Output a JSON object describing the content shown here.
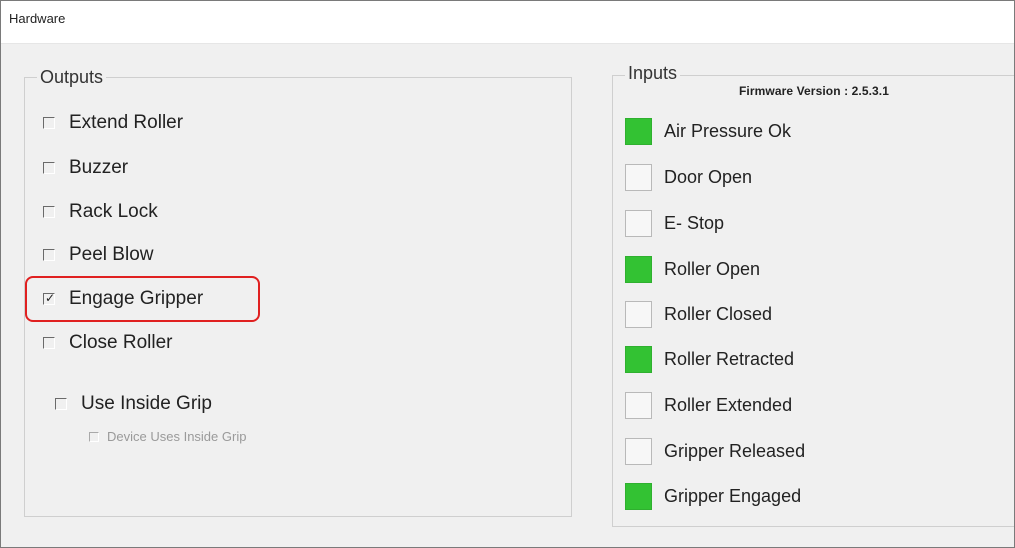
{
  "window": {
    "title": "Hardware"
  },
  "outputs": {
    "legend": "Outputs",
    "items": [
      {
        "label": "Extend Roller",
        "checked": false
      },
      {
        "label": "Buzzer",
        "checked": false
      },
      {
        "label": "Rack Lock",
        "checked": false
      },
      {
        "label": "Peel Blow",
        "checked": false
      },
      {
        "label": "Engage Gripper",
        "checked": true
      },
      {
        "label": "Close Roller",
        "checked": false
      }
    ],
    "use_inside_grip": {
      "label": "Use Inside Grip",
      "checked": false
    },
    "device_uses_inside_grip": {
      "label": "Device Uses Inside Grip",
      "checked": false,
      "disabled": true
    }
  },
  "inputs": {
    "legend": "Inputs",
    "firmware_version": "Firmware Version : 2.5.3.1",
    "items": [
      {
        "label": "Air Pressure Ok",
        "active": true
      },
      {
        "label": "Door Open",
        "active": false
      },
      {
        "label": "E- Stop",
        "active": false
      },
      {
        "label": "Roller Open",
        "active": true
      },
      {
        "label": "Roller Closed",
        "active": false
      },
      {
        "label": "Roller Retracted",
        "active": true
      },
      {
        "label": "Roller Extended",
        "active": false
      },
      {
        "label": "Gripper Released",
        "active": false
      },
      {
        "label": "Gripper Engaged",
        "active": true
      }
    ]
  },
  "colors": {
    "indicator_on": "#33c233",
    "highlight": "#e02020"
  }
}
